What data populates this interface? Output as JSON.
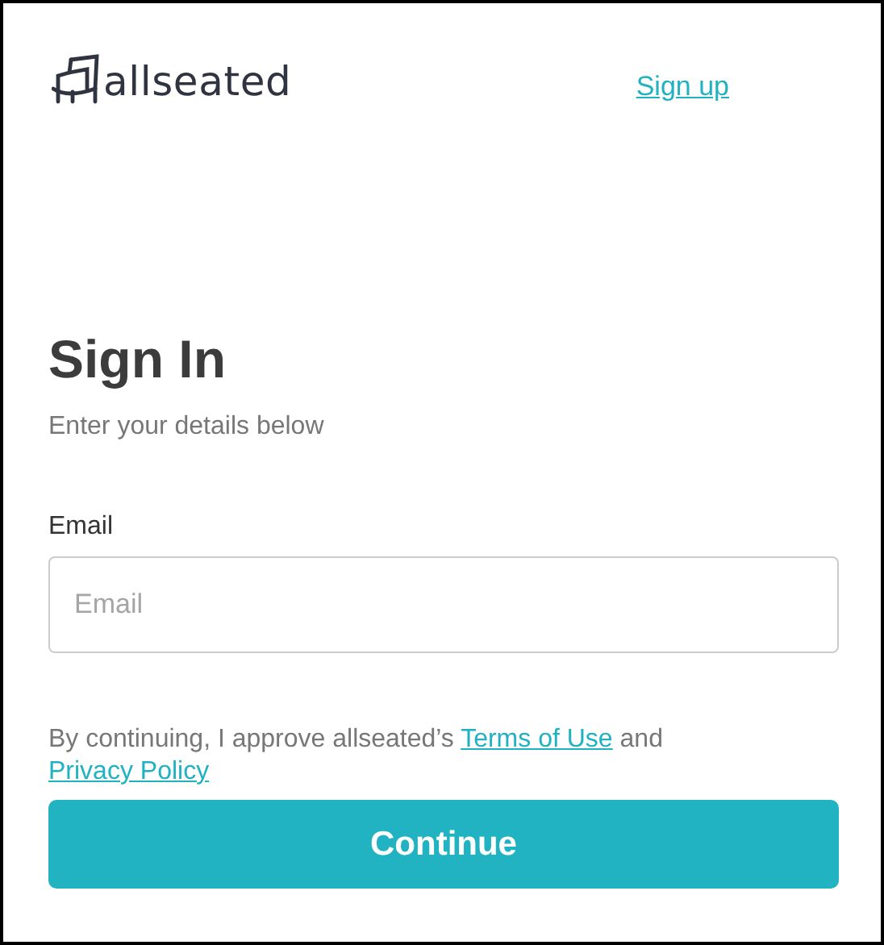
{
  "header": {
    "logo": "allseated",
    "signup_link": "Sign up"
  },
  "title": "Sign In",
  "subtitle": "Enter your details below",
  "email": {
    "label": "Email",
    "placeholder": "Email"
  },
  "consent": [
    {
      "kind": "text",
      "text": "By continuing, I approve allseated’s "
    },
    {
      "kind": "link",
      "text": "Terms of Use"
    },
    {
      "kind": "text",
      "text": " and "
    },
    {
      "kind": "link",
      "text": "Privacy Policy"
    }
  ],
  "button": "Continue"
}
